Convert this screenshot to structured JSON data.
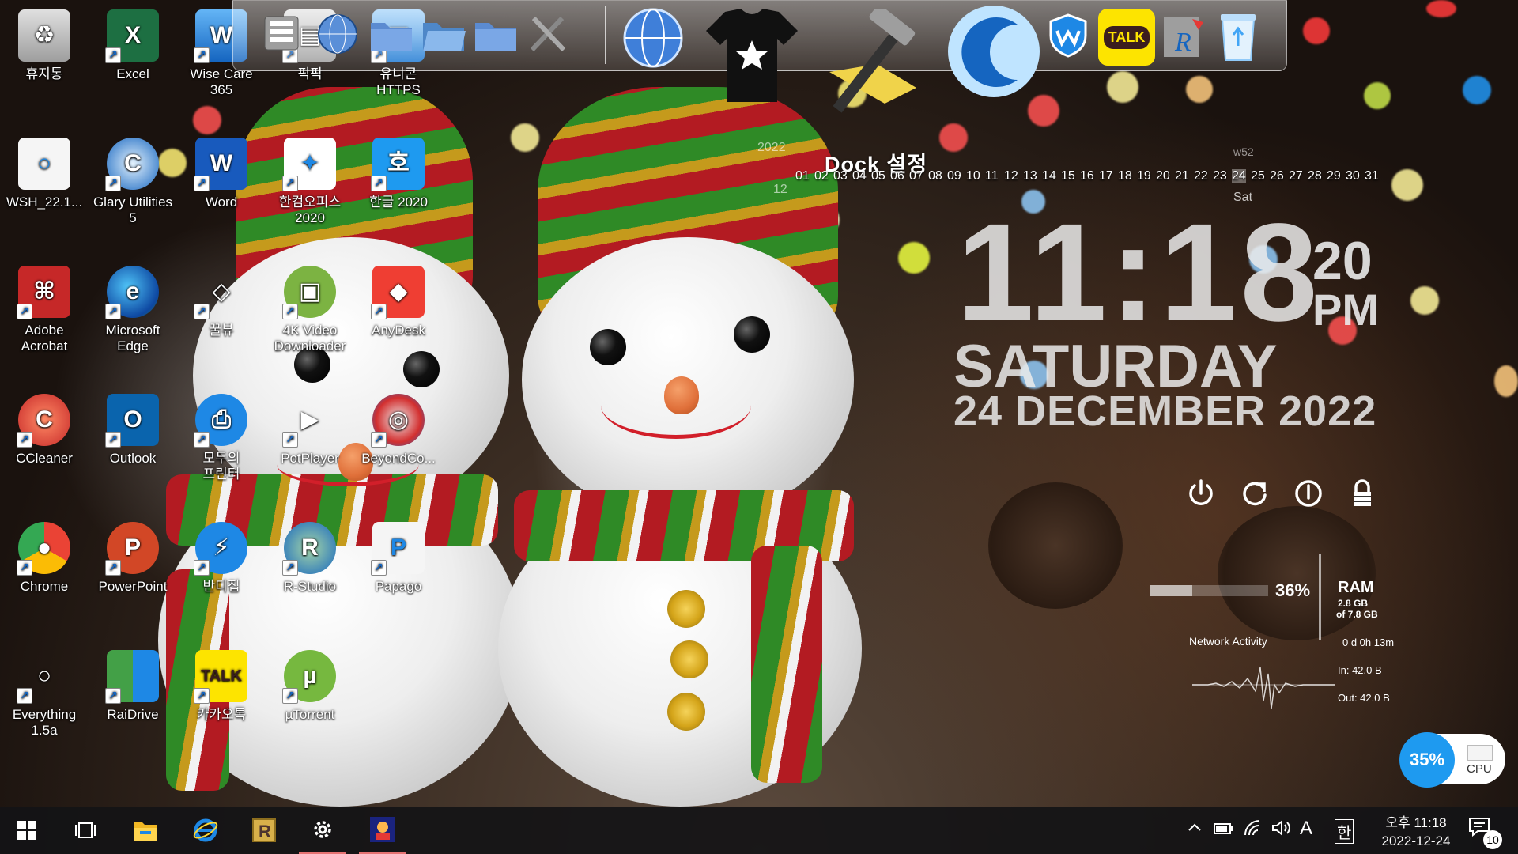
{
  "desktop": {
    "icons": [
      {
        "label": "휴지통",
        "icon": "recycle-bin-icon"
      },
      {
        "label": "Excel",
        "icon": "excel-icon"
      },
      {
        "label": "Wise Care\n365",
        "icon": "wise-care-icon"
      },
      {
        "label": "픽픽",
        "icon": "picpick-icon"
      },
      {
        "label": "유니콘\nHTTPS",
        "icon": "unicorn-https-icon"
      },
      {
        "label": "WSH_22.1...",
        "icon": "wsh-file-icon"
      },
      {
        "label": "Glary Utilities\n5",
        "icon": "glary-utilities-icon"
      },
      {
        "label": "Word",
        "icon": "word-icon"
      },
      {
        "label": "한컴오피스\n2020",
        "icon": "hancom-office-icon"
      },
      {
        "label": "한글 2020",
        "icon": "hangul-icon"
      },
      {
        "label": "Adobe\nAcrobat",
        "icon": "adobe-acrobat-icon"
      },
      {
        "label": "Microsoft\nEdge",
        "icon": "edge-icon"
      },
      {
        "label": "꿀뷰",
        "icon": "honeyview-icon"
      },
      {
        "label": "4K Video\nDownloader",
        "icon": "4k-video-downloader-icon"
      },
      {
        "label": "AnyDesk",
        "icon": "anydesk-icon"
      },
      {
        "label": "CCleaner",
        "icon": "ccleaner-icon"
      },
      {
        "label": "Outlook",
        "icon": "outlook-icon"
      },
      {
        "label": "모두의\n프린터",
        "icon": "printer-icon"
      },
      {
        "label": "PotPlayer",
        "icon": "potplayer-icon"
      },
      {
        "label": "BeyondCo...",
        "icon": "beyond-compare-icon"
      },
      {
        "label": "Chrome",
        "icon": "chrome-icon"
      },
      {
        "label": "PowerPoint",
        "icon": "powerpoint-icon"
      },
      {
        "label": "반디집",
        "icon": "bandizip-icon"
      },
      {
        "label": "R-Studio",
        "icon": "r-studio-icon"
      },
      {
        "label": "Papago",
        "icon": "papago-icon"
      },
      {
        "label": "Everything\n1.5a",
        "icon": "everything-icon"
      },
      {
        "label": "RaiDrive",
        "icon": "raidrive-icon"
      },
      {
        "label": "카카오톡",
        "icon": "kakaotalk-icon"
      },
      {
        "label": "µTorrent",
        "icon": "utorrent-icon"
      }
    ]
  },
  "dock": {
    "settings_label": "Dock 설정",
    "items": [
      "file-manager-icon",
      "globe-icon",
      "folder-icon",
      "folder-open-icon",
      "folder-icon",
      "tools-icon",
      "globe-network-icon",
      "tshirt-icon",
      "hammer-icon",
      "glary-icon",
      "wise-shield-icon",
      "kakaotalk-icon",
      "r-studio-icon",
      "recycle-bin-icon"
    ],
    "kakao_label": "TALK"
  },
  "calendar": {
    "year": "2022",
    "month": "12",
    "week": "w52",
    "days": [
      "01",
      "02",
      "03",
      "04",
      "05",
      "06",
      "07",
      "08",
      "09",
      "10",
      "11",
      "12",
      "13",
      "14",
      "15",
      "16",
      "17",
      "18",
      "19",
      "20",
      "21",
      "22",
      "23",
      "24",
      "25",
      "26",
      "27",
      "28",
      "29",
      "30",
      "31"
    ],
    "today": "24",
    "dow": "Sat"
  },
  "clock": {
    "time": "11:18",
    "seconds": "20",
    "ampm": "PM",
    "day": "SATURDAY",
    "date": "24 DECEMBER  2022"
  },
  "power": {
    "shutdown": "⏻",
    "restart": "⟳",
    "logoff": "ⓘ",
    "lock": "🔒"
  },
  "system": {
    "ram_percent": "36%",
    "ram_fraction": 0.36,
    "ram_label": "RAM",
    "ram_used": "2.8 GB",
    "ram_total": "of 7.8 GB",
    "network_label": "Network Activity",
    "uptime": "0 d 0h 13m",
    "net_in": "In: 42.0 B",
    "net_out": "Out: 42.0 B",
    "cpu_percent": "35%",
    "cpu_label": "CPU"
  },
  "taskbar": {
    "items": [
      "start-icon",
      "task-view-icon",
      "file-explorer-icon",
      "internet-explorer-icon",
      "raidrive-icon",
      "settings-icon",
      "app-icon"
    ],
    "tray_time": "오후 11:18",
    "tray_date": "2022-12-24",
    "ime_a": "A",
    "ime_han": "한",
    "notification_count": "10"
  },
  "colors": {
    "accent_blue": "#1e9af0",
    "taskbar": "#141416",
    "active_indicator": "#e57373"
  }
}
